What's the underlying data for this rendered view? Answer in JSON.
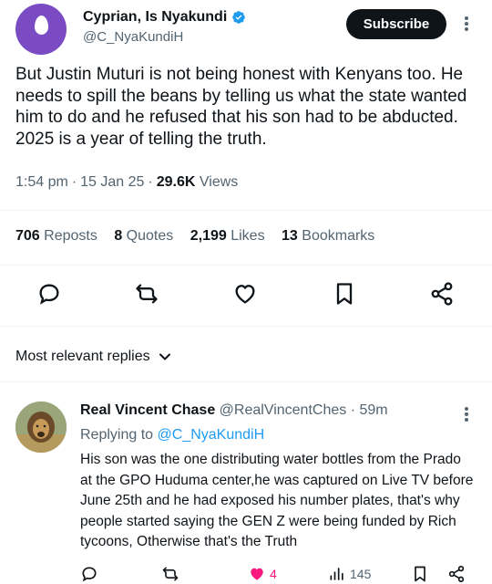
{
  "tweet": {
    "author_name": "Cyprian, Is Nyakundi",
    "author_handle": "@C_NyaKundiH",
    "subscribe_label": "Subscribe",
    "text": "But Justin Muturi is not being honest with Kenyans too. He needs to spill the beans by telling us what the state wanted him to do and he refused that his son had to be abducted. 2025 is a year of telling the truth.",
    "time": "1:54 pm",
    "date": "15 Jan 25",
    "views_count": "29.6K",
    "views_label": "Views",
    "accent_color": "#1d9bf0"
  },
  "stats": {
    "reposts": {
      "count": "706",
      "label": "Reposts"
    },
    "quotes": {
      "count": "8",
      "label": "Quotes"
    },
    "likes": {
      "count": "2,199",
      "label": "Likes"
    },
    "bookmarks": {
      "count": "13",
      "label": "Bookmarks"
    }
  },
  "actions": [
    "reply-icon",
    "repost-icon",
    "like-icon",
    "bookmark-icon",
    "share-icon"
  ],
  "replies_filter": {
    "label": "Most relevant replies"
  },
  "reply": {
    "author_name": "Real Vincent Chase",
    "author_handle": "@RealVincentChes",
    "time": "59m",
    "replying_prefix": "Replying to",
    "replying_to": "@C_NyaKundiH",
    "text": "His son was the one distributing water bottles from the Prado at the GPO Huduma center,he was captured on Live TV before June 25th and he had exposed his number plates, that's why people started saying the GEN Z were being funded by Rich tycoons, Otherwise that's the Truth",
    "likes": "4",
    "views": "145",
    "like_color": "#f91880"
  }
}
